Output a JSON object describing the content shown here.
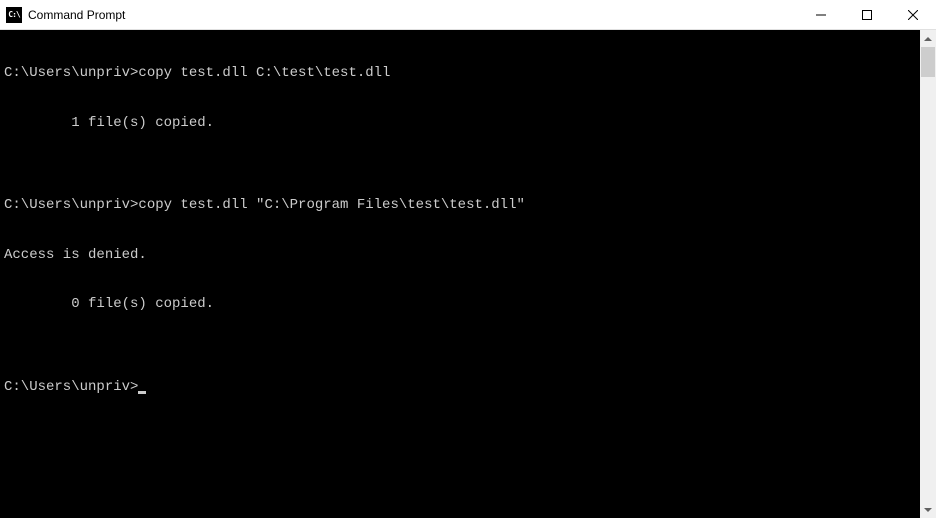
{
  "titlebar": {
    "icon_label": "C:\\",
    "title": "Command Prompt"
  },
  "terminal": {
    "lines": [
      {
        "prompt": "C:\\Users\\unpriv>",
        "command": "copy test.dll C:\\test\\test.dll"
      },
      {
        "text": "        1 file(s) copied."
      },
      {
        "text": ""
      },
      {
        "prompt": "C:\\Users\\unpriv>",
        "command": "copy test.dll \"C:\\Program Files\\test\\test.dll\""
      },
      {
        "text": "Access is denied."
      },
      {
        "text": "        0 file(s) copied."
      },
      {
        "text": ""
      }
    ],
    "current_prompt": "C:\\Users\\unpriv>"
  }
}
